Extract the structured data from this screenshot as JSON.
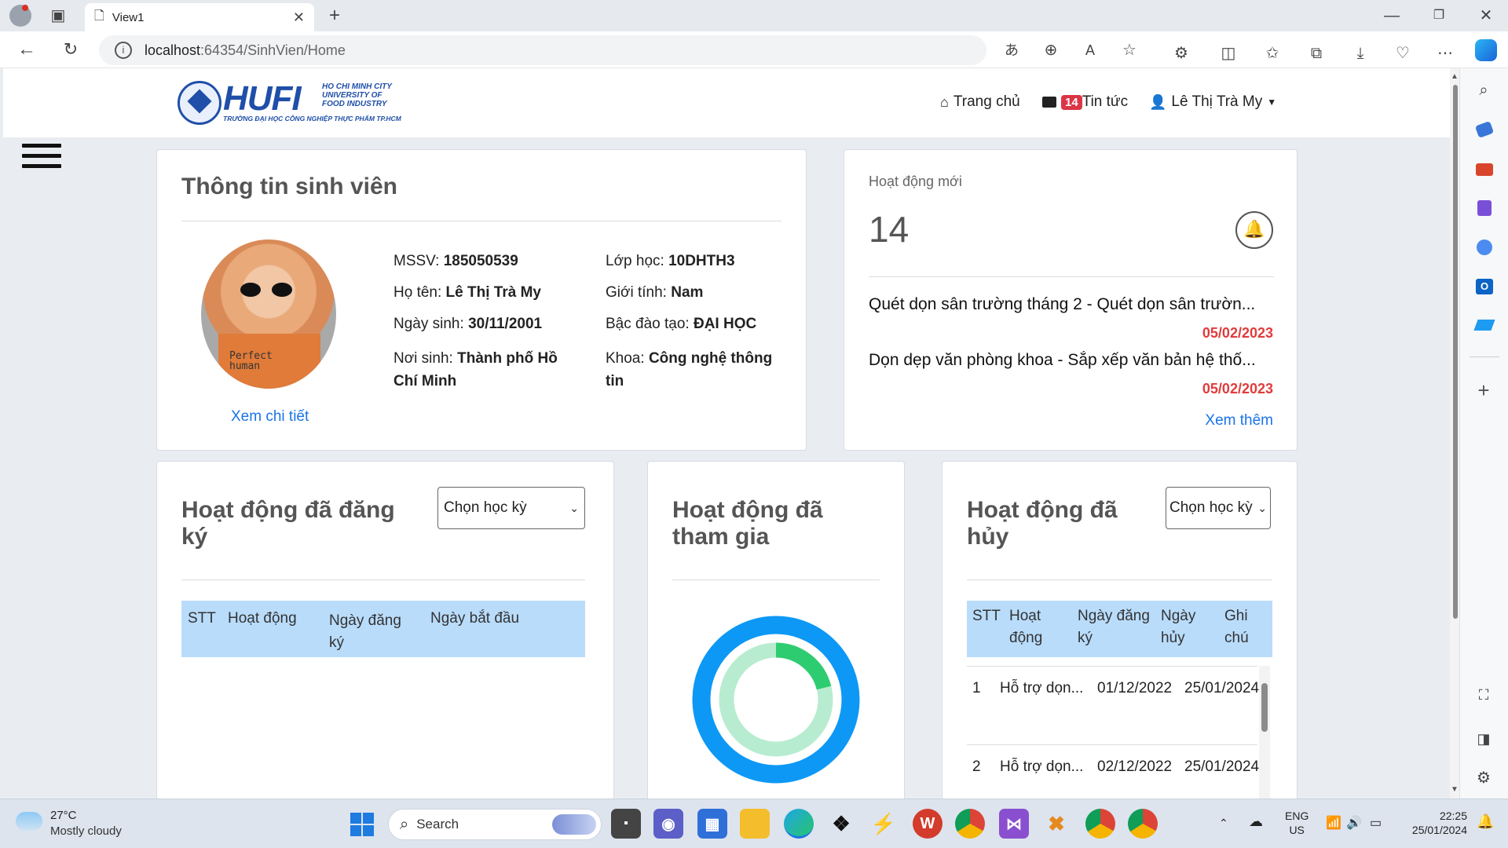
{
  "browser": {
    "tab_title": "View1",
    "url_host": "localhost",
    "url_rest": ":64354/SinhVien/Home"
  },
  "nav": {
    "logo_main": "HUFI",
    "logo_sub1": "HO CHI MINH CITY",
    "logo_sub2": "UNIVERSITY OF",
    "logo_sub3": "FOOD INDUSTRY",
    "logo_tagline": "TRƯỜNG ĐẠI HỌC CÔNG NGHIỆP THỰC PHẨM TP.HCM",
    "home": "Trang chủ",
    "news_badge": "14",
    "news": "Tin tức",
    "user": "Lê Thị Trà My"
  },
  "student": {
    "title": "Thông tin sinh viên",
    "detail_link": "Xem chi tiết",
    "avatar_text": "Perfect human",
    "mssv_label": "MSSV:",
    "mssv": "185050539",
    "name_label": "Họ tên:",
    "name": "Lê Thị Trà My",
    "dob_label": "Ngày sinh:",
    "dob": "30/11/2001",
    "pob_label": "Nơi sinh:",
    "pob1": "Thành phố Hồ",
    "pob2": "Chí Minh",
    "class_label": "Lớp học:",
    "class": "10DHTH3",
    "gender_label": "Giới tính:",
    "gender": "Nam",
    "level_label": "Bậc đào tạo:",
    "level": "ĐẠI HỌC",
    "faculty_label": "Khoa:",
    "faculty1": "Công nghệ thông",
    "faculty2": "tin"
  },
  "activity": {
    "title": "Hoạt động mới",
    "count": "14",
    "items": [
      {
        "text": "Quét dọn sân trường tháng 2 - Quét dọn sân trườn...",
        "date": "05/02/2023"
      },
      {
        "text": "Dọn dẹp văn phòng khoa - Sắp xếp văn bản hệ thố...",
        "date": "05/02/2023"
      }
    ],
    "more": "Xem thêm"
  },
  "registered": {
    "title1": "Hoạt động đã đăng",
    "title2": "ký",
    "select": "Chọn học kỳ",
    "cols": [
      "STT",
      "Hoạt động",
      "Ngày đăng",
      "ký",
      "Ngày bắt đầu"
    ]
  },
  "joined": {
    "title1": "Hoạt động đã",
    "title2": "tham gia"
  },
  "cancelled": {
    "title1": "Hoạt động đã",
    "title2": "hủy",
    "select": "Chọn học kỳ",
    "cols": [
      "STT",
      "Hoạt",
      "động",
      "Ngày đăng",
      "ký",
      "Ngày",
      "hủy",
      "Ghi",
      "chú"
    ],
    "rows": [
      {
        "stt": "1",
        "name": "Hỗ trợ dọn...",
        "reg": "01/12/2022",
        "cancel": "25/01/2024"
      },
      {
        "stt": "2",
        "name": "Hỗ trợ dọn...",
        "reg": "02/12/2022",
        "cancel": "25/01/2024"
      }
    ]
  },
  "taskbar": {
    "temp": "27°C",
    "weather": "Mostly cloudy",
    "search": "Search",
    "lang1": "ENG",
    "lang2": "US",
    "time": "22:25",
    "date": "25/01/2024"
  },
  "colors": {
    "accent": "#1a73e8",
    "badge": "#dc3545",
    "table_head": "#b9dcfb",
    "donut_outer": "#0d98f5",
    "donut_inner": "#b8ecd0",
    "donut_arc": "#2ecc71"
  }
}
